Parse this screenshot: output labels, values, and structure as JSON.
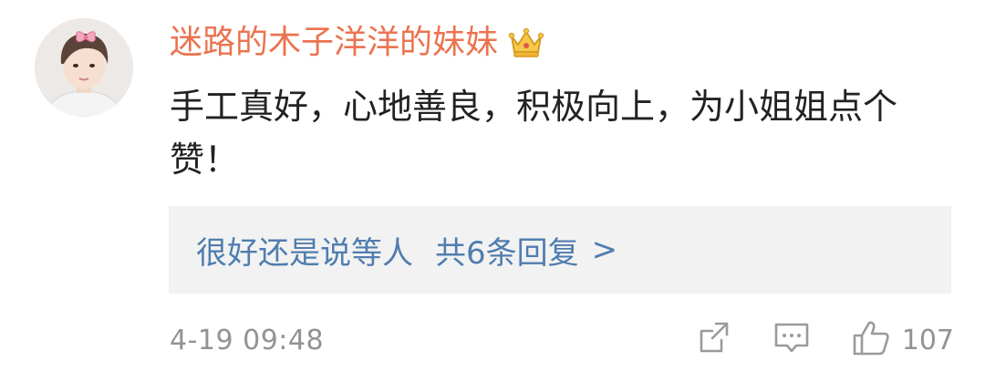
{
  "comment": {
    "username": "迷路的木子洋洋的妹妹",
    "badge_icon": "crown-icon",
    "text": "手工真好，心地善良，积极向上，为小姐姐点个赞！",
    "reply_preview": {
      "author": "很好还是说等人",
      "count_label": "共6条回复",
      "arrow": ">"
    },
    "timestamp": "4-19 09:48",
    "actions": {
      "share_icon": "share-icon",
      "reply_icon": "comment-icon",
      "like_icon": "thumbs-up-icon",
      "like_count": "107"
    }
  },
  "colors": {
    "username": "#eb7350",
    "link": "#507daf",
    "meta": "#939393",
    "reply_bg": "#f2f2f2"
  }
}
